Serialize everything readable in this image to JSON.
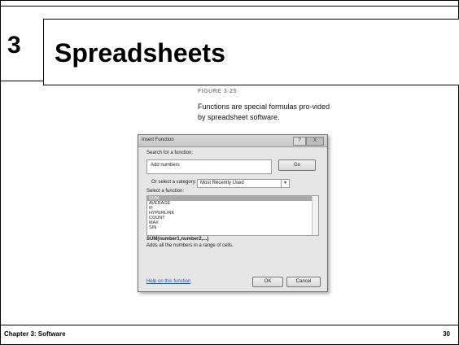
{
  "slide": {
    "chapter_number": "3",
    "title": "Spreadsheets",
    "figure_label": "FIGURE 3-25",
    "caption": "Functions are special formulas pro-vided by spreadsheet software.",
    "footer_left": "Chapter 3: Software",
    "footer_right": "30"
  },
  "dialog": {
    "title": "Insert Function",
    "help_glyph": "?",
    "close_glyph": "X",
    "search_label": "Search for a function:",
    "search_value": "Add numbers",
    "go_label": "Go",
    "category_label": "Or select a category:",
    "category_value": "Most Recently Used",
    "select_label": "Select a function:",
    "functions": [
      "SUM",
      "AVERAGE",
      "IF",
      "HYPERLINK",
      "COUNT",
      "MAX",
      "SIN"
    ],
    "selected_function": "SUM",
    "signature": "SUM(number1,number2,...)",
    "description": "Adds all the numbers in a range of cells.",
    "help_link": "Help on this function",
    "ok_label": "OK",
    "cancel_label": "Cancel"
  }
}
